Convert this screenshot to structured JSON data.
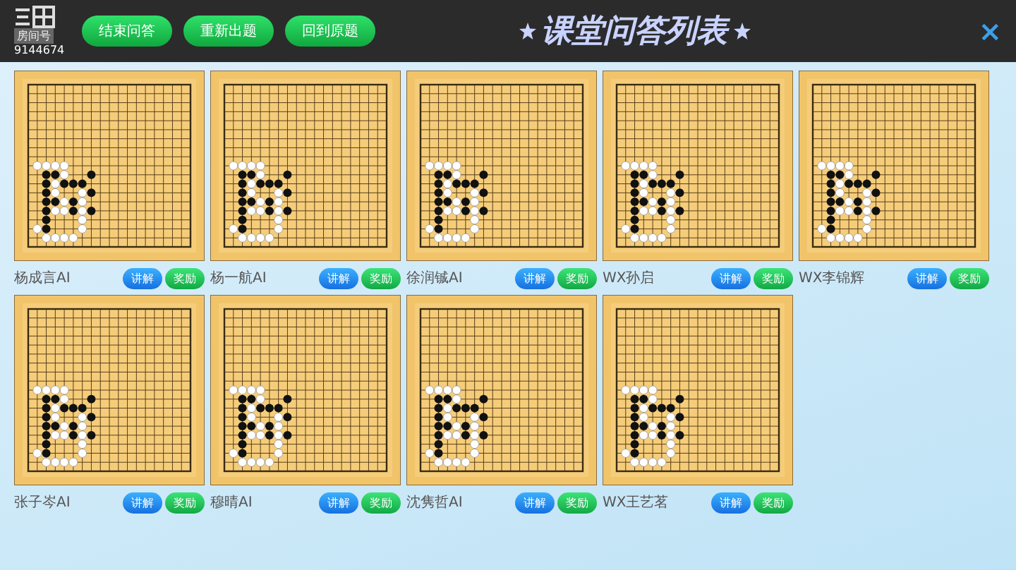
{
  "header": {
    "room_label": "房间号",
    "room_number": "9144674",
    "buttons": [
      "结束问答",
      "重新出题",
      "回到原题"
    ],
    "title": "课堂问答列表",
    "close": "×"
  },
  "boards": [
    {
      "name": "杨成言AI",
      "explain": "讲解",
      "reward": "奖励"
    },
    {
      "name": "杨一航AI",
      "explain": "讲解",
      "reward": "奖励"
    },
    {
      "name": "徐润铖AI",
      "explain": "讲解",
      "reward": "奖励"
    },
    {
      "name": "WX孙启",
      "explain": "讲解",
      "reward": "奖励"
    },
    {
      "name": "WX李锦辉",
      "explain": "讲解",
      "reward": "奖励"
    },
    {
      "name": "张子岑AI",
      "explain": "讲解",
      "reward": "奖励"
    },
    {
      "name": "穆晴AI",
      "explain": "讲解",
      "reward": "奖励"
    },
    {
      "name": "沈隽哲AI",
      "explain": "讲解",
      "reward": "奖励"
    },
    {
      "name": "WX王艺茗",
      "explain": "讲解",
      "reward": "奖励"
    }
  ]
}
